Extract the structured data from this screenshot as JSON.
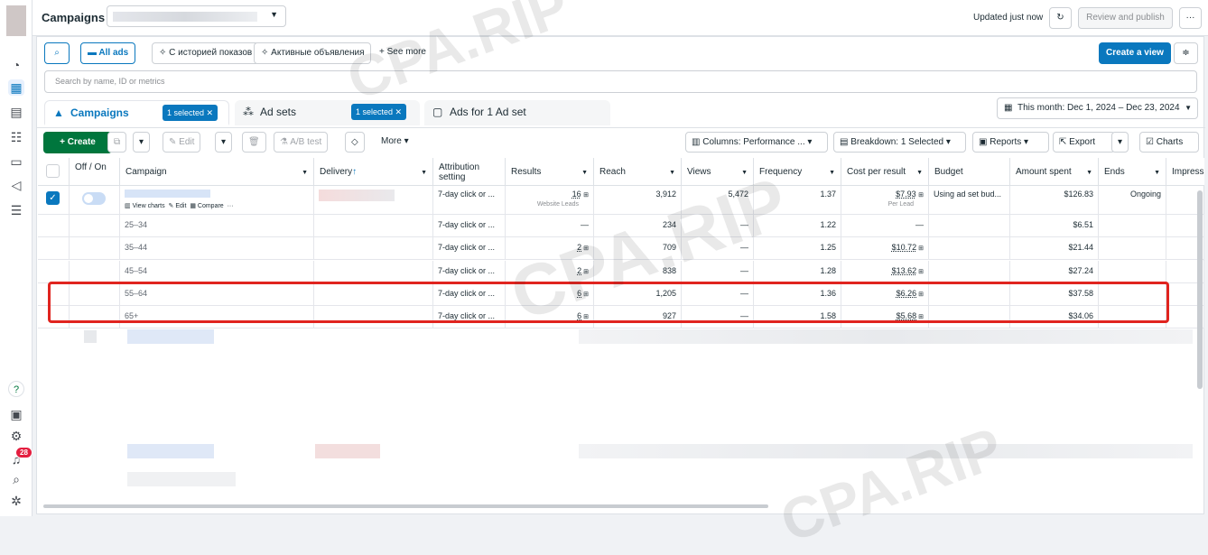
{
  "header": {
    "title": "Campaigns",
    "updated": "Updated just now",
    "review_publish": "Review and publish",
    "more": "···"
  },
  "filters": {
    "all_ads": "All ads",
    "history": "С историей показов",
    "active_ads": "Активные объявления",
    "see_more": "See more",
    "create_view": "Create a view",
    "search_placeholder": "Search by name, ID or metrics"
  },
  "tabs": [
    {
      "label": "Campaigns",
      "badge": "1 selected"
    },
    {
      "label": "Ad sets",
      "badge": "1 selected"
    },
    {
      "label": "Ads for 1 Ad set"
    }
  ],
  "date_range": "This month: Dec 1, 2024 – Dec 23, 2024",
  "toolbar": {
    "create": "Create",
    "edit": "Edit",
    "ab_test": "A/B test",
    "more": "More",
    "columns": "Columns: Performance ...",
    "breakdown": "Breakdown: 1 Selected",
    "reports": "Reports",
    "export": "Export",
    "charts": "Charts"
  },
  "columns": [
    "Off / On",
    "Campaign",
    "Delivery",
    "Attribution setting",
    "Results",
    "Reach",
    "Views",
    "Frequency",
    "Cost per result",
    "Budget",
    "Amount spent",
    "Ends",
    "Impress"
  ],
  "campaign_row": {
    "attribution": "7-day click or ...",
    "results": "16",
    "results_sub": "Website Leads",
    "reach": "3,912",
    "views": "5,472",
    "frequency": "1.37",
    "cost": "$7.93",
    "cost_sub": "Per Lead",
    "budget": "Using ad set bud...",
    "spent": "$126.83",
    "ends": "Ongoing",
    "actions": {
      "view_charts": "View charts",
      "edit": "Edit",
      "compare": "Compare",
      "more": "···"
    }
  },
  "breakdown_rows": [
    {
      "age": "25–34",
      "attribution": "7-day click or ...",
      "results": "—",
      "reach": "234",
      "views": "—",
      "frequency": "1.22",
      "cost": "—",
      "spent": "$6.51"
    },
    {
      "age": "35–44",
      "attribution": "7-day click or ...",
      "results": "2",
      "reach": "709",
      "views": "—",
      "frequency": "1.25",
      "cost": "$10.72",
      "spent": "$21.44"
    },
    {
      "age": "45–54",
      "attribution": "7-day click or ...",
      "results": "2",
      "reach": "838",
      "views": "—",
      "frequency": "1.28",
      "cost": "$13.62",
      "spent": "$27.24"
    },
    {
      "age": "55–64",
      "attribution": "7-day click or ...",
      "results": "6",
      "reach": "1,205",
      "views": "—",
      "frequency": "1.36",
      "cost": "$6.26",
      "spent": "$37.58"
    },
    {
      "age": "65+",
      "attribution": "7-day click or ...",
      "results": "6",
      "reach": "927",
      "views": "—",
      "frequency": "1.58",
      "cost": "$5.68",
      "spent": "$34.06"
    }
  ],
  "notifications": "28",
  "watermark": "CPA.RIP"
}
